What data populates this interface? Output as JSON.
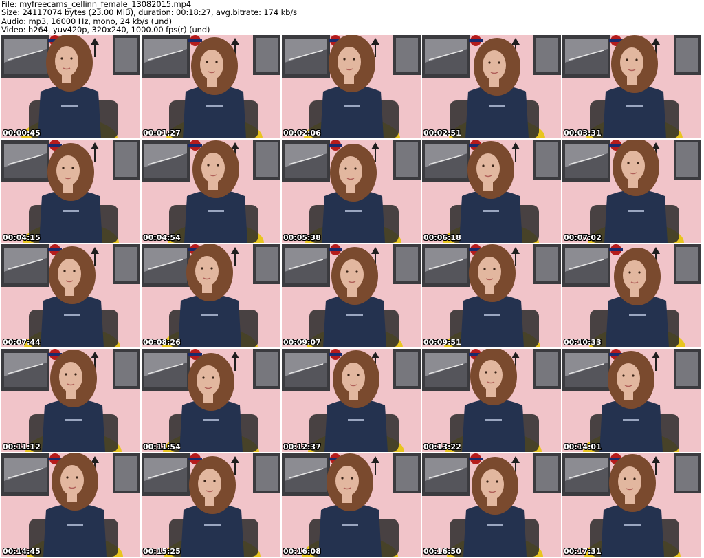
{
  "header": {
    "file_line": "File: myfreecams_cellinn_female_13082015.mp4",
    "size_line": "Size: 24117074 bytes (23.00 MiB), duration: 00:18:27, avg.bitrate: 174 kb/s",
    "audio_line": "Audio: mp3, 16000 Hz, mono, 24 kb/s (und)",
    "video_line": "Video: h264, yuv420p, 320x240, 1000.00 fps(r) (und)"
  },
  "thumbnails": [
    {
      "timestamp": "00:00:45"
    },
    {
      "timestamp": "00:01:27"
    },
    {
      "timestamp": "00:02:06"
    },
    {
      "timestamp": "00:02:51"
    },
    {
      "timestamp": "00:03:31"
    },
    {
      "timestamp": "00:04:15"
    },
    {
      "timestamp": "00:04:54"
    },
    {
      "timestamp": "00:05:38"
    },
    {
      "timestamp": "00:06:18"
    },
    {
      "timestamp": "00:07:02"
    },
    {
      "timestamp": "00:07:44"
    },
    {
      "timestamp": "00:08:26"
    },
    {
      "timestamp": "00:09:07"
    },
    {
      "timestamp": "00:09:51"
    },
    {
      "timestamp": "00:10:33"
    },
    {
      "timestamp": "00:11:12"
    },
    {
      "timestamp": "00:11:54"
    },
    {
      "timestamp": "00:12:37"
    },
    {
      "timestamp": "00:13:22"
    },
    {
      "timestamp": "00:14:01"
    },
    {
      "timestamp": "00:14:45"
    },
    {
      "timestamp": "00:15:25"
    },
    {
      "timestamp": "00:16:08"
    },
    {
      "timestamp": "00:16:50"
    },
    {
      "timestamp": "00:17:31"
    }
  ],
  "colors": {
    "wall_pink": "#f1c4c9",
    "poster_dark": "#3b3b3f",
    "shirt_navy": "#24324f",
    "hair_brown": "#7a4a2e",
    "skin": "#e2b79f",
    "shorts_yellow": "#e8c51f",
    "lamp_black": "#1e1e1e",
    "timestamp_text": "#ffffff"
  }
}
